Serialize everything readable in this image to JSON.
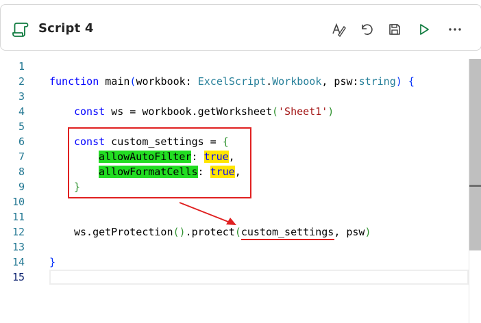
{
  "header": {
    "title": "Script 4",
    "script_icon": "script-scroll-icon",
    "tools": [
      "spell-check-icon",
      "undo-icon",
      "save-icon",
      "run-icon",
      "more-options-icon"
    ]
  },
  "editor": {
    "line_numbers": [
      "1",
      "2",
      "3",
      "4",
      "5",
      "6",
      "7",
      "8",
      "9",
      "10",
      "11",
      "12",
      "13",
      "14",
      "15"
    ],
    "active_line": "15",
    "code": {
      "l2": {
        "kw": "function",
        "name": " main",
        "p1": "(",
        "a": "workbook: ",
        "t1": "ExcelScript",
        "dot": ".",
        "t2": "Workbook",
        "b": ", psw:",
        "t3": "string",
        "p2": ")",
        "sp": " ",
        "br": "{"
      },
      "l4": {
        "kw": "const",
        "a": " ws = workbook.getWorksheet",
        "p1": "(",
        "s": "'Sheet1'",
        "p2": ")"
      },
      "l6": {
        "kw": "const",
        "a": " custom_settings = ",
        "br": "{"
      },
      "l7": {
        "prop": "allowAutoFilter",
        "colon": ": ",
        "val": "true",
        "comma": ","
      },
      "l8": {
        "prop": "allowFormatCells",
        "colon": ": ",
        "val": "true",
        "comma": ","
      },
      "l9": {
        "br": "}"
      },
      "l12": {
        "a": "ws.getProtection",
        "p1": "()",
        "b": ".protect",
        "p2": "(",
        "arg": "custom_settings",
        "rest": ", psw",
        "p3": ")"
      },
      "l14": {
        "br": "}"
      }
    }
  },
  "colors": {
    "keyword": "#0000ff",
    "type": "#267f99",
    "string": "#a31515",
    "line_number": "#237893",
    "highlight_green": "#22dd22",
    "highlight_yellow": "#ffe500",
    "annotation_red": "#e02020"
  }
}
